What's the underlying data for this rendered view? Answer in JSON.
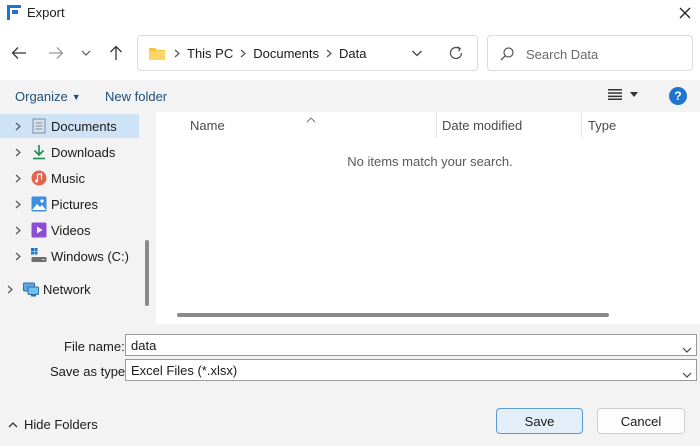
{
  "window": {
    "title": "Export"
  },
  "address": {
    "crumbs": [
      "This PC",
      "Documents",
      "Data"
    ]
  },
  "search": {
    "placeholder": "Search Data"
  },
  "toolbar": {
    "organize_label": "Organize",
    "new_folder_label": "New folder",
    "help_label": "?"
  },
  "sidebar": {
    "items": [
      {
        "label": "Documents",
        "icon": "documents-icon",
        "selected": true
      },
      {
        "label": "Downloads",
        "icon": "downloads-icon"
      },
      {
        "label": "Music",
        "icon": "music-icon"
      },
      {
        "label": "Pictures",
        "icon": "pictures-icon"
      },
      {
        "label": "Videos",
        "icon": "videos-icon"
      },
      {
        "label": "Windows (C:)",
        "icon": "drive-icon"
      },
      {
        "label": "Network",
        "icon": "network-icon"
      }
    ]
  },
  "filelist": {
    "columns": [
      "Name",
      "Date modified",
      "Type"
    ],
    "empty_message": "No items match your search."
  },
  "form": {
    "file_name_label": "File name:",
    "file_name_value": "data",
    "save_as_type_label": "Save as type:",
    "save_as_type_value": "Excel Files (*.xlsx)"
  },
  "footer": {
    "hide_folders_label": "Hide Folders",
    "save_label": "Save",
    "cancel_label": "Cancel"
  },
  "colors": {
    "accent": "#1e74cf",
    "selection": "#cfe3f7",
    "command_text": "#1f4e79"
  }
}
